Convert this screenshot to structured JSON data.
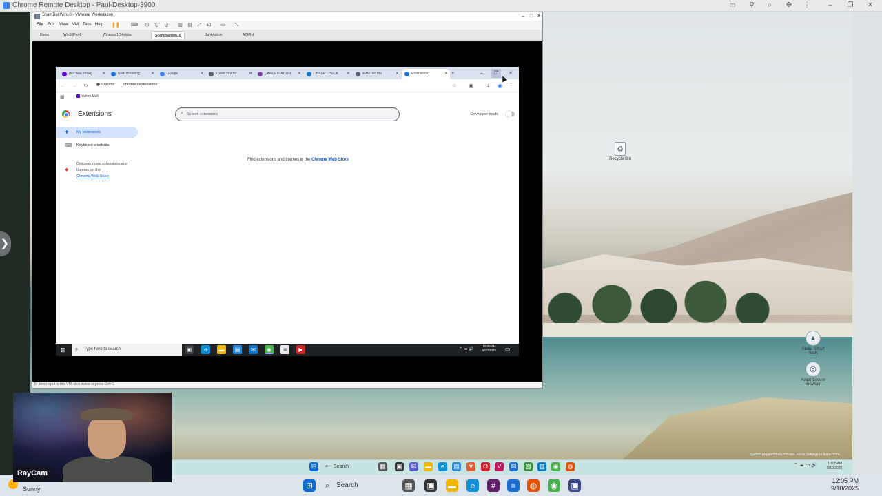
{
  "crd": {
    "title": "Chrome Remote Desktop - Paul-Desktop-3900",
    "side_toggle": "❯",
    "toolbar_icons": [
      "dock-icon",
      "pin-icon",
      "zoom-icon",
      "extensions-icon",
      "more-icon",
      "minimize-icon",
      "restore-icon",
      "close-icon"
    ]
  },
  "vmware": {
    "title": "ScamBaitWin10 - VMware Workstation",
    "menu": [
      "File",
      "Edit",
      "View",
      "VM",
      "Tabs",
      "Help"
    ],
    "tabs": [
      "Home",
      "Win10Pro-0",
      "Windows10-Adobe",
      "ScamBaitWin10",
      "BankAdmin",
      "ADMIN"
    ],
    "active_tab": "ScamBaitWin10",
    "status_text": "To direct input to this VM, click inside or press Ctrl+G."
  },
  "guest_chrome": {
    "tabs": [
      {
        "label": "(No new email)",
        "color": "#6001d2"
      },
      {
        "label": "Utah Breaking",
        "color": "#1a73e8"
      },
      {
        "label": "Google",
        "color": "#4285f4"
      },
      {
        "label": "Thank you for",
        "color": "#5f6368"
      },
      {
        "label": "CANCELLATION",
        "color": "#7b3fa0"
      },
      {
        "label": "CHASE CHECK",
        "color": "#117aca"
      },
      {
        "label": "www.hell.top",
        "color": "#5f6368"
      },
      {
        "label": "Extensions",
        "color": "#1a73e8"
      }
    ],
    "new_tab": "+",
    "chip_label": "Chrome",
    "url": "chrome://extensions",
    "bookmark": "Yahoo Mail"
  },
  "extensions_page": {
    "title": "Extensions",
    "search_placeholder": "Search extensions",
    "developer_mode_label": "Developer mode",
    "developer_mode_on": false,
    "nav_my_extensions": "My extensions",
    "nav_keyboard_shortcuts": "Keyboard shortcuts",
    "discover_text": "Discover more extensions and themes on the",
    "discover_link": "Chrome Web Store",
    "find_text": "Find extensions and themes in the",
    "find_link": "Chrome Web Store"
  },
  "guest_taskbar": {
    "search_placeholder": "Type here to search",
    "time": "10:05 AM",
    "date": "9/10/2025"
  },
  "remote_desktop": {
    "icons": [
      "Recycle Bin",
      "Stoke Smart Tools",
      "Avast Secure Browser"
    ],
    "system_requirements": "System requirements not met. Go to Settings to learn more.",
    "taskbar_search": "Search",
    "time": "10:05 AM",
    "date": "9/10/2025"
  },
  "local_taskbar": {
    "weather": "Sunny",
    "search": "Search",
    "time": "12:05 PM",
    "date": "9/10/2025"
  },
  "raycam": {
    "label": "RayCam"
  }
}
